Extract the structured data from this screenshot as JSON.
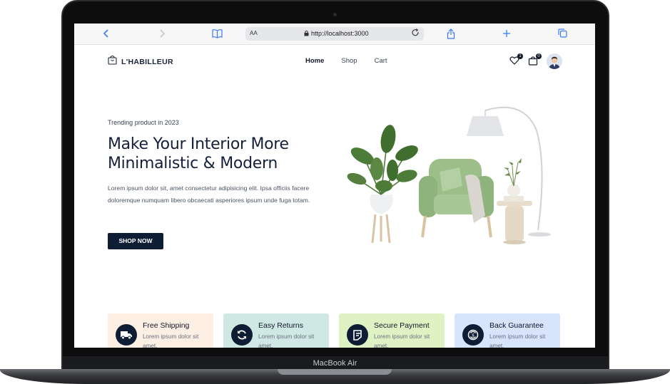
{
  "device": {
    "label": "MacBook Air"
  },
  "browser": {
    "aa_label": "AA",
    "url": "http://localhost:3000"
  },
  "site": {
    "brand": "L'HABILLEUR",
    "nav": {
      "home": "Home",
      "shop": "Shop",
      "cart": "Cart"
    },
    "wishlist_count": "1",
    "cart_count": "0"
  },
  "hero": {
    "eyebrow": "Trending product in 2023",
    "title": "Make Your Interior More Minimalistic & Modern",
    "description": "Lorem ipsum dolor sit, amet consectetur adipisicing elit. Ipsa officiis facere doloremque numquam libero obcaecati asperiores ipsum unde fuga totam.",
    "cta": "SHOP NOW"
  },
  "features": [
    {
      "title": "Free Shipping",
      "text": "Lorem ipsum dolor sit amet.",
      "bg": "#fdefe4",
      "icon": "truck-icon"
    },
    {
      "title": "Easy Returns",
      "text": "Lorem ipsum dolor sit amet.",
      "bg": "#cfe8e4",
      "icon": "refresh-icon"
    },
    {
      "title": "Secure Payment",
      "text": "Lorem ipsum dolor sit amet.",
      "bg": "#dff2c4",
      "icon": "payment-icon"
    },
    {
      "title": "Back Guarantee",
      "text": "Lorem ipsum dolor sit amet.",
      "bg": "#d8e4fc",
      "icon": "guarantee-icon"
    }
  ],
  "colors": {
    "primary": "#0f1d34",
    "accent_safari": "#3b7cf6"
  }
}
